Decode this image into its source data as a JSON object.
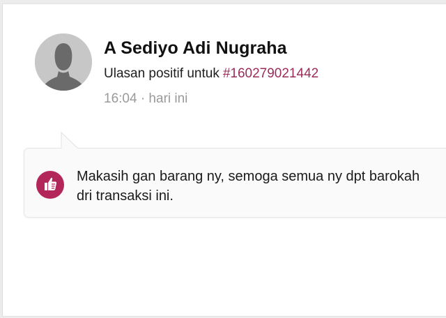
{
  "review": {
    "reviewer_name": "A Sediyo Adi Nugraha",
    "summary_prefix": "Ulasan positif untuk",
    "order_id": "#160279021442",
    "time": "16:04 · hari ini",
    "message": "Makasih gan barang ny, semoga semua ny dpt barokah dri transaksi ini.",
    "sentiment_icon": "thumbs-up-icon"
  },
  "colors": {
    "accent": "#9b2b59",
    "badge": "#b3265a",
    "muted": "#9a9a9a",
    "avatar_bg": "#c7c7c7"
  }
}
